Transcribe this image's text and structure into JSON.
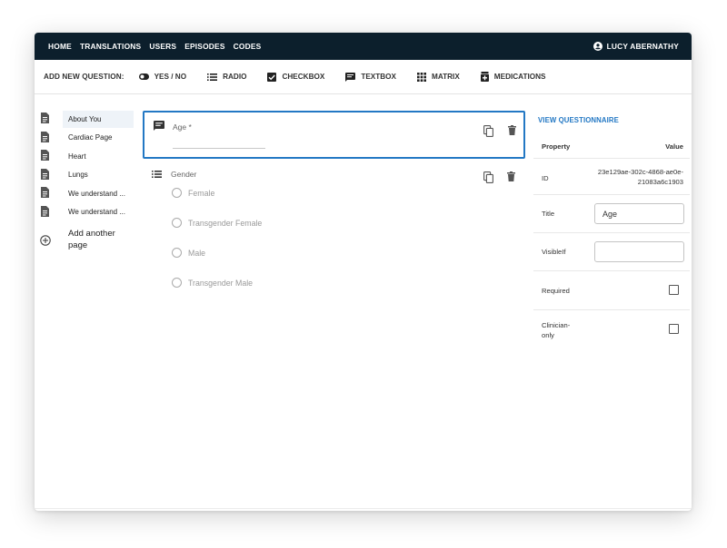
{
  "nav": {
    "items": [
      "HOME",
      "TRANSLATIONS",
      "USERS",
      "EPISODES",
      "CODES"
    ],
    "user_name": "LUCY ABERNATHY"
  },
  "toolbar": {
    "label": "ADD NEW QUESTION:",
    "buttons": [
      {
        "label": "YES / NO",
        "icon": "toggle-icon"
      },
      {
        "label": "RADIO",
        "icon": "list-icon"
      },
      {
        "label": "CHECKBOX",
        "icon": "checkbox-icon"
      },
      {
        "label": "TEXTBOX",
        "icon": "textbox-icon"
      },
      {
        "label": "MATRIX",
        "icon": "grid-icon"
      },
      {
        "label": "MEDICATIONS",
        "icon": "medication-icon"
      }
    ]
  },
  "sidebar": {
    "pages": [
      "About You",
      "Cardiac Page",
      "Heart",
      "Lungs",
      "We understand ...",
      "We understand ..."
    ],
    "active_index": 0,
    "add_label": "Add another page"
  },
  "questions": {
    "age": {
      "label": "Age *"
    },
    "gender": {
      "label": "Gender",
      "options": [
        "Female",
        "Transgender Female",
        "Male",
        "Transgender Male"
      ]
    }
  },
  "properties": {
    "view_link": "VIEW QUESTIONNAIRE",
    "header_property": "Property",
    "header_value": "Value",
    "id_label": "ID",
    "id_value_line1": "23e129ae-302c-4868-ae0e-",
    "id_value_line2": "21083a6c1903",
    "title_label": "Title",
    "title_value": "Age",
    "visibleif_label": "VisibleIf",
    "visibleif_value": "",
    "required_label": "Required",
    "required_checked": false,
    "clinician_label_line1": "Clinician-",
    "clinician_label_line2": "only",
    "clinician_checked": false
  },
  "colors": {
    "nav_bg": "#0c1f2c",
    "accent": "#2378c4"
  }
}
